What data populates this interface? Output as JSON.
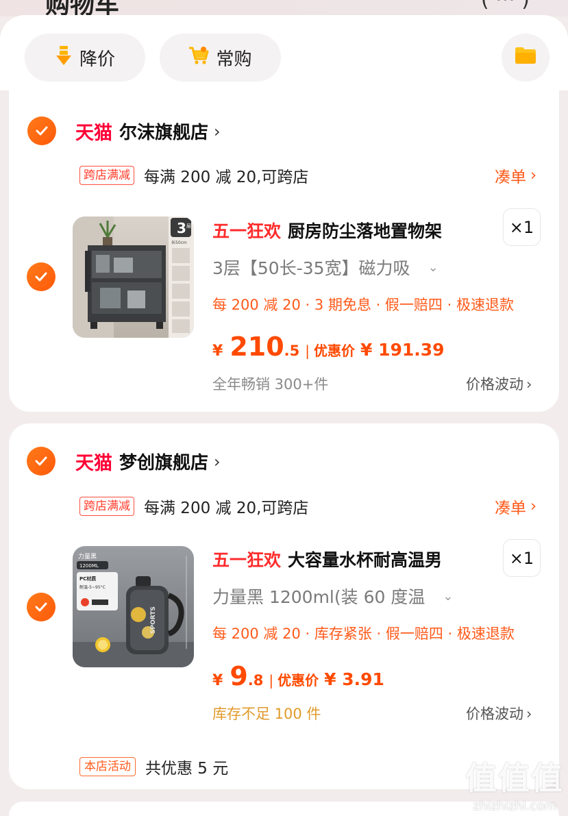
{
  "header": {
    "title": "购物车",
    "right_glyph": "( ··· )"
  },
  "filters": {
    "price_drop": "降价",
    "frequent": "常购"
  },
  "stores": [
    {
      "platform": "天猫",
      "name": "尔沫旗舰店",
      "promo_tag": "跨店满减",
      "promo_text": "每满 200 减 20,可跨店",
      "promo_link": "凑单",
      "product": {
        "event": "五一狂欢",
        "title": "厨房防尘落地置物架",
        "qty": "×1",
        "sku": "3层【50长-35宽】磁力吸",
        "benefits": "每 200 减 20 · 3 期免息 · 假一赔四 · 极速退款",
        "currency": "¥",
        "price_int": "210",
        "price_dec": ".5",
        "deal_label": "优惠价",
        "deal_price": "¥ 191.39",
        "footnote": "全年畅销 300+件",
        "price_trend": "价格波动",
        "thumb_badge": "3",
        "thumb_badge_sub": "层",
        "thumb_size": "长50cm"
      }
    },
    {
      "platform": "天猫",
      "name": "梦创旗舰店",
      "promo_tag": "跨店满减",
      "promo_text": "每满 200 减 20,可跨店",
      "promo_link": "凑单",
      "product": {
        "event": "五一狂欢",
        "title": "大容量水杯耐高温男",
        "qty": "×1",
        "sku": "力量黑 1200ml(装 60 度温",
        "benefits": "每 200 减 20 · 库存紧张 · 假一赔四 · 极速退款",
        "currency": "¥",
        "price_int": "9",
        "price_dec": ".8",
        "deal_label": "优惠价",
        "deal_price": "¥ 3.91",
        "footnote": "库存不足 100 件",
        "price_trend": "价格波动",
        "thumb_title": "力量黑",
        "thumb_volume": "1200ML",
        "thumb_spec": "PC材质",
        "thumb_temp": "耐温-5~95°C",
        "thumb_brand": "SPORTS"
      },
      "activity_tag": "本店活动",
      "activity_text": "共优惠 5 元"
    }
  ],
  "watermark": {
    "big": "值值值",
    "small": "zhizhizhi.com"
  },
  "colors": {
    "accent": "#ff5a0a",
    "tmall": "#ff0036",
    "price": "#ff4a00"
  }
}
